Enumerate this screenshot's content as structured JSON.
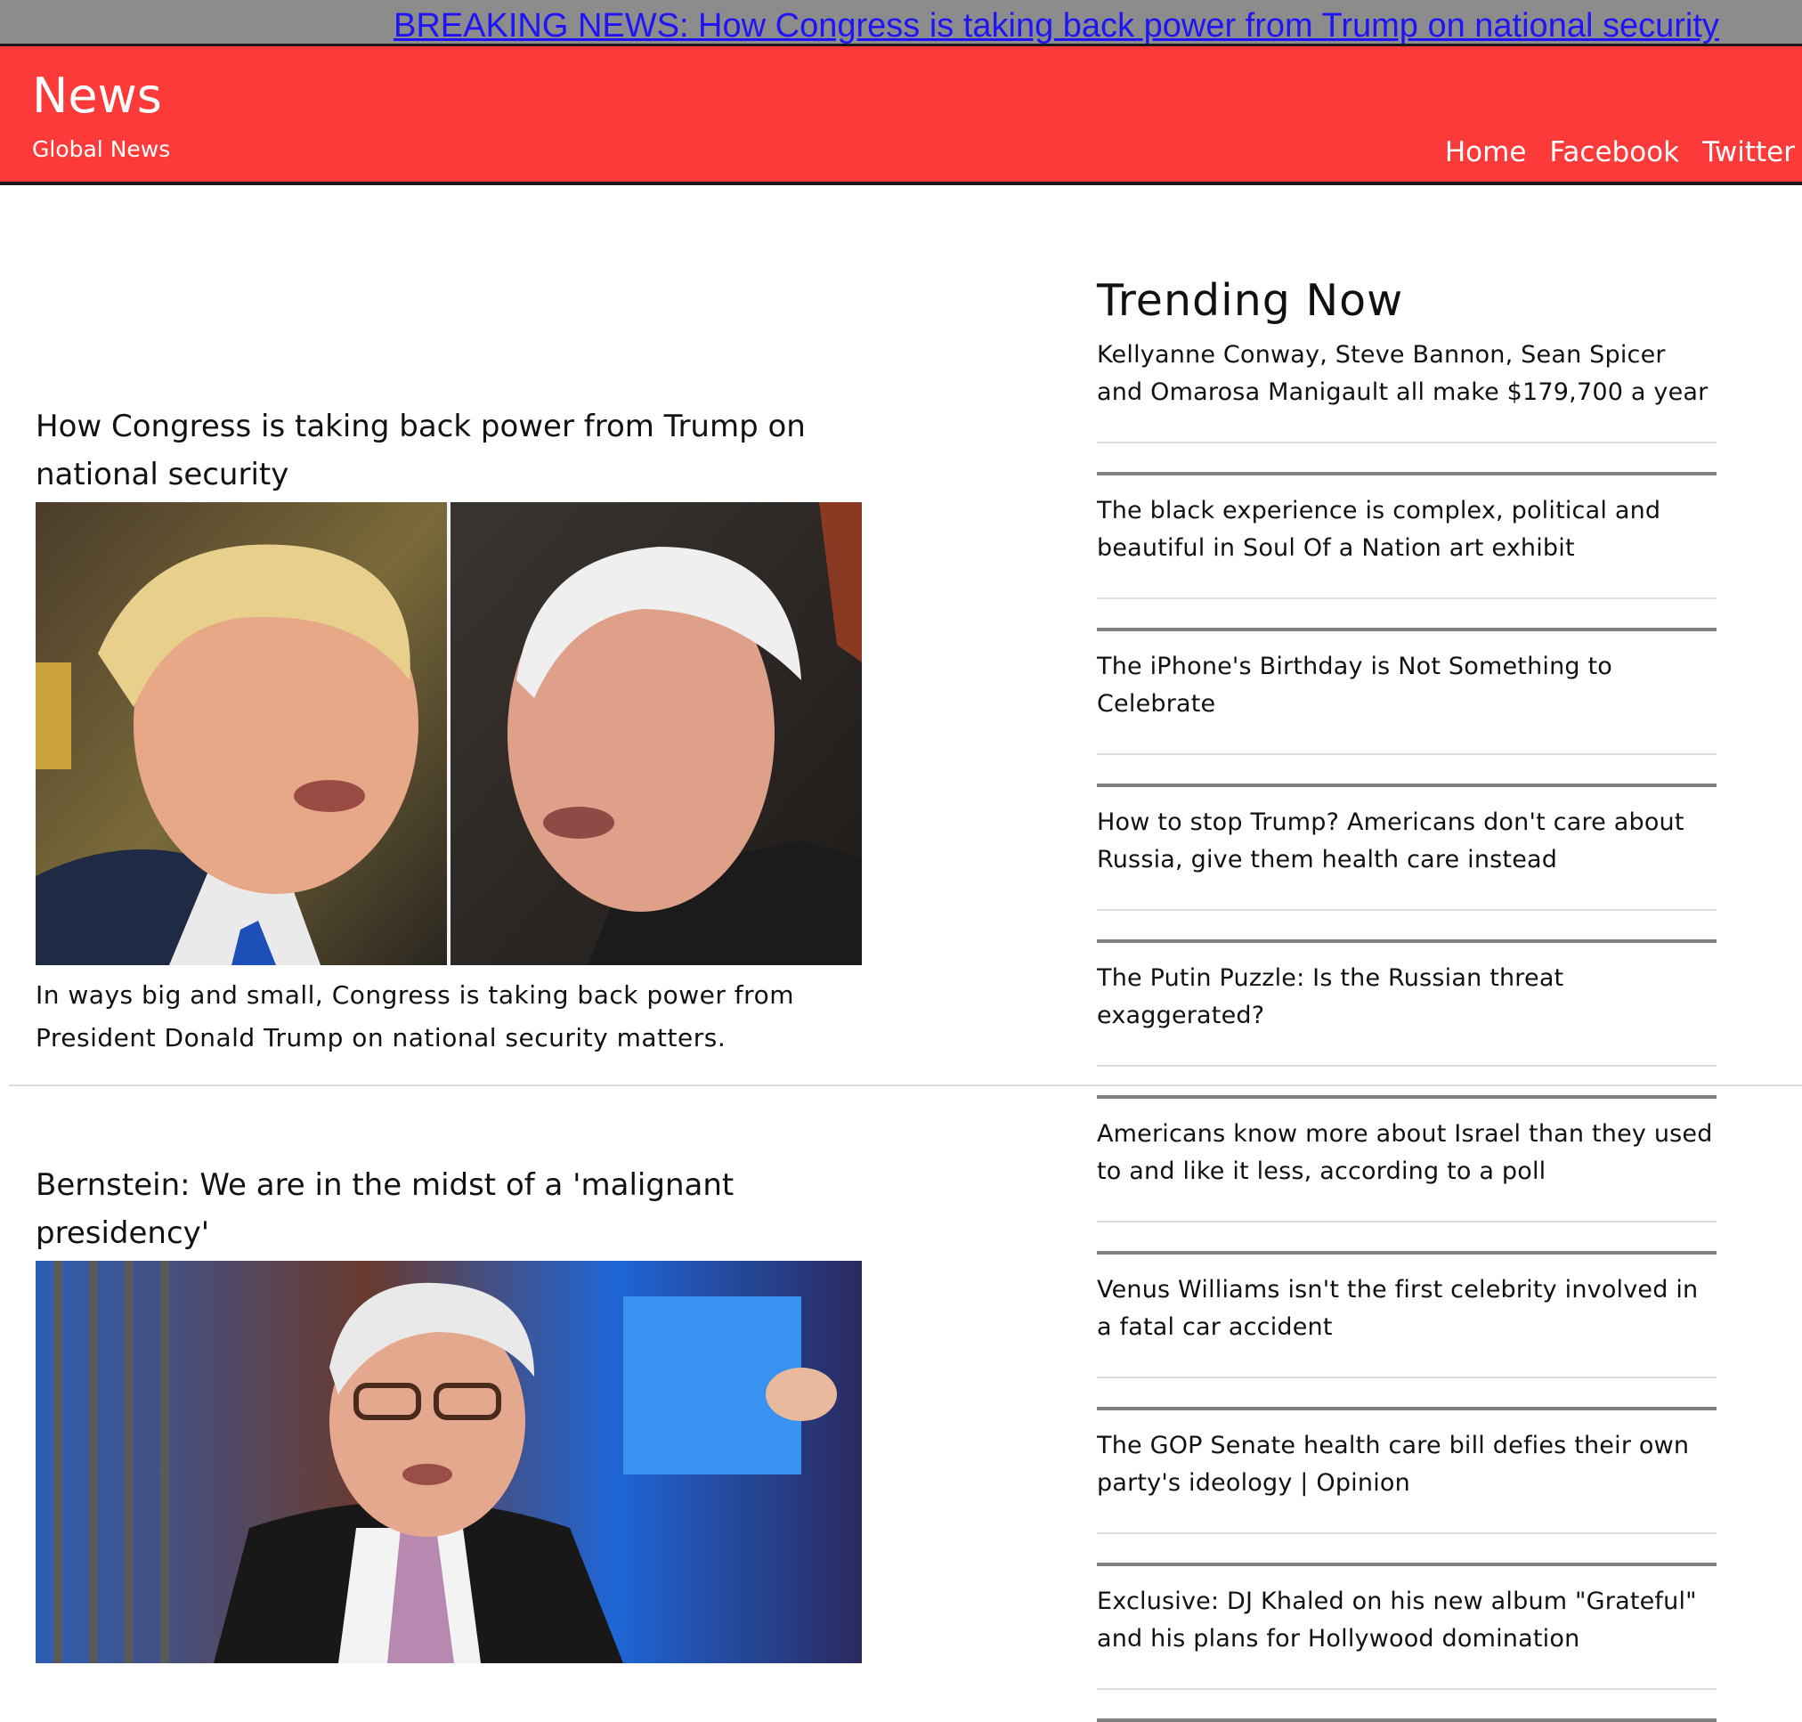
{
  "ticker": {
    "text": "BREAKING NEWS: How Congress is taking back power from Trump on national security"
  },
  "header": {
    "title": "News",
    "subtitle": "Global News",
    "nav": [
      "Home",
      "Facebook",
      "Twitter"
    ]
  },
  "articles": [
    {
      "title": "How Congress is taking back power from Trump on national security",
      "summary": "In ways big and small, Congress is taking back power from President Donald Trump on national security matters."
    },
    {
      "title": "Bernstein: We are in the midst of a 'malignant presidency'"
    }
  ],
  "trending": {
    "heading": "Trending Now",
    "items": [
      "Kellyanne Conway, Steve Bannon, Sean Spicer and Omarosa Manigault all make $179,700 a year",
      "The black experience is complex, political and beautiful in Soul Of a Nation art exhibit",
      "The iPhone's Birthday is Not Something to Celebrate",
      "How to stop Trump? Americans don't care about Russia, give them health care instead",
      "The Putin Puzzle: Is the Russian threat exaggerated?",
      "Americans know more about Israel than they used to and like it less, according to a poll",
      "Venus Williams isn't the first celebrity involved in a fatal car accident",
      "The GOP Senate health care bill defies their own party's ideology | Opinion",
      "Exclusive: DJ Khaled on his new album \"Grateful\" and his plans for Hollywood domination"
    ]
  },
  "colors": {
    "header_bg": "#fd3a3a",
    "ticker_bg": "#8c8c8c",
    "ticker_text": "#1e14f5"
  }
}
